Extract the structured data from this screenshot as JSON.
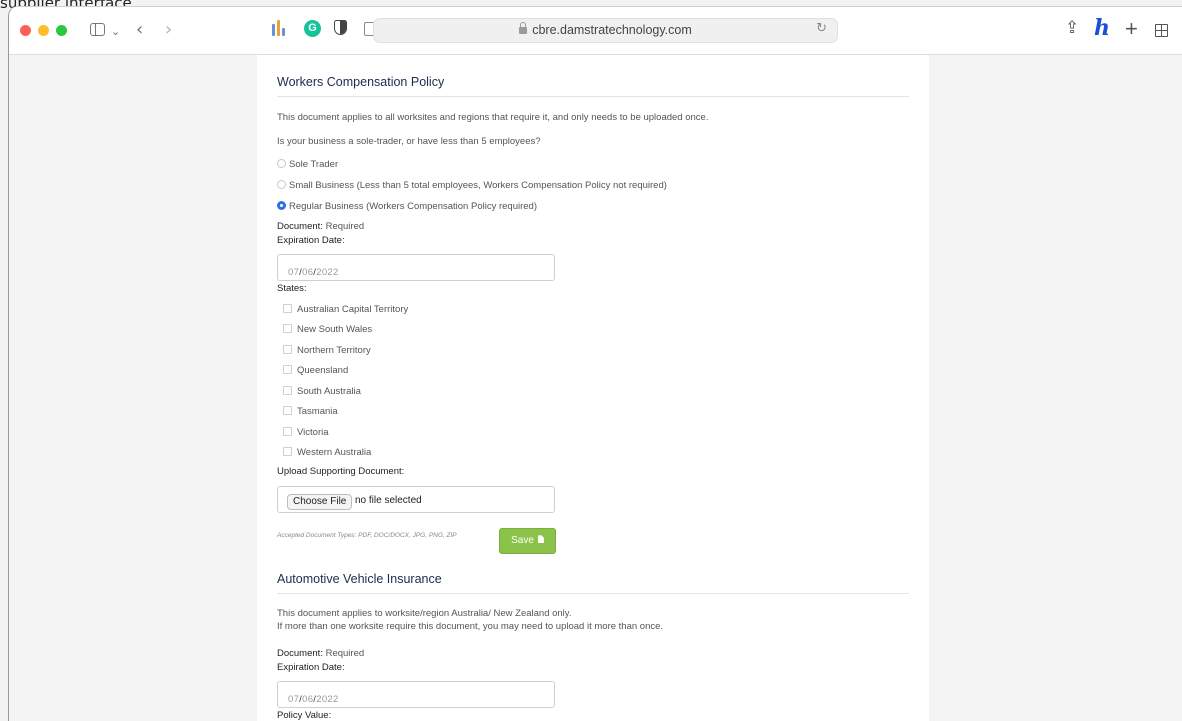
{
  "caption": "supplier interface",
  "browser": {
    "url": "cbre.damstratechnology.com",
    "traffic_colors": [
      "#ff5f57",
      "#febc2e",
      "#28c840"
    ]
  },
  "workers_comp": {
    "title": "Workers Compensation Policy",
    "intro": "This document applies to all worksites and regions that require it, and only needs to be uploaded once.",
    "question": "Is your business a sole-trader, or have less than 5 employees?",
    "options": [
      {
        "label": "Sole Trader",
        "checked": false
      },
      {
        "label": "Small Business (Less than 5 total employees, Workers Compensation Policy not required)",
        "checked": false
      },
      {
        "label": "Regular Business (Workers Compensation Policy required)",
        "checked": true
      }
    ],
    "document_label": "Document",
    "document_value": "Required",
    "expiration_label": "Expiration Date",
    "date": {
      "month": "07",
      "day": "06",
      "year": "2022"
    },
    "states_label": "States",
    "states": [
      "Australian Capital Territory",
      "New South Wales",
      "Northern Territory",
      "Queensland",
      "South Australia",
      "Tasmania",
      "Victoria",
      "Western Australia"
    ],
    "upload_label": "Upload Supporting Document",
    "choose_file": "Choose File",
    "no_file": "no file selected",
    "accepted_types": "Accepted Document Types: PDF, DOC/DOCX, JPG, PNG, ZIP",
    "save_label": "Save"
  },
  "vehicle": {
    "title": "Automotive Vehicle Insurance",
    "intro_line1": "This document applies to worksite/region Australia/ New Zealand only.",
    "intro_line2": "If more than one worksite require this document, you may need to upload it more than once.",
    "document_label": "Document",
    "document_value": "Required",
    "expiration_label": "Expiration Date",
    "date": {
      "month": "07",
      "day": "06",
      "year": "2022"
    },
    "policy_value_label": "Policy Value"
  }
}
